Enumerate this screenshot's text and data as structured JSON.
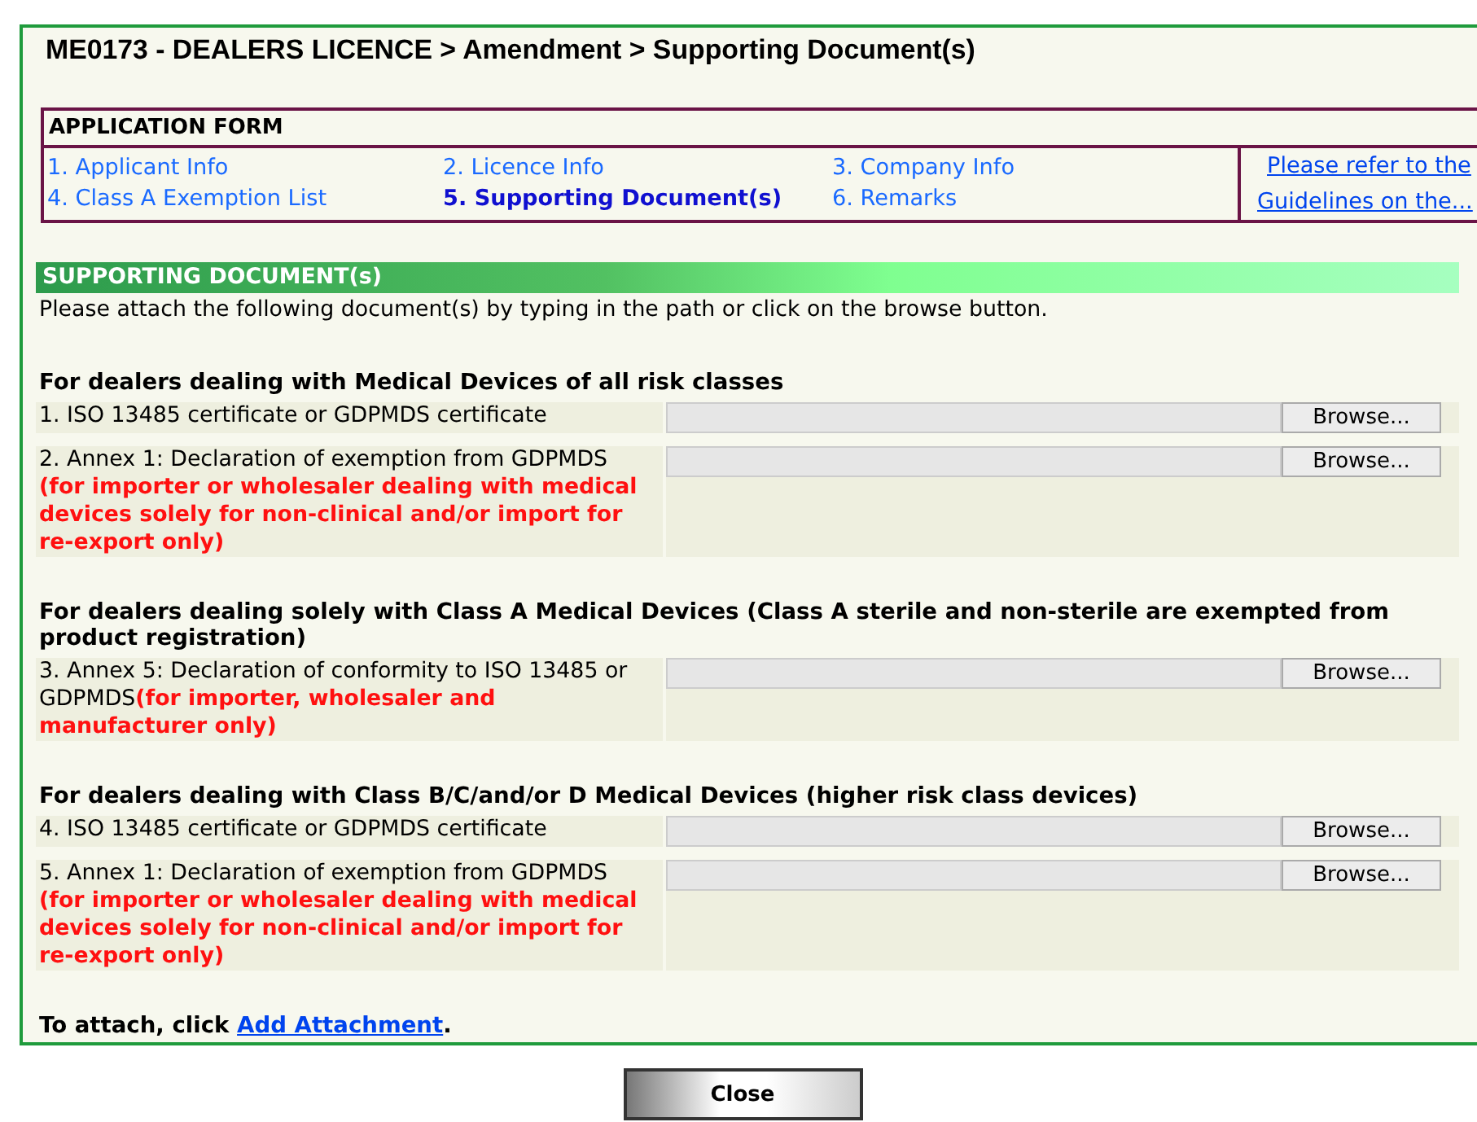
{
  "window": {
    "title": "ME0173 - DEALERS LICENCE > Amendment > Supporting Document(s)"
  },
  "application_form": {
    "title": "APPLICATION FORM",
    "steps": [
      {
        "label": "1. Applicant Info",
        "selected": false
      },
      {
        "label": "2. Licence Info",
        "selected": false
      },
      {
        "label": "3. Company Info",
        "selected": false
      },
      {
        "label": "4. Class A Exemption List",
        "selected": false
      },
      {
        "label": "5. Supporting Document(s)",
        "selected": true
      },
      {
        "label": "6. Remarks",
        "selected": false
      }
    ],
    "guideline_links": [
      "Please refer to the",
      "Guidelines on the..."
    ]
  },
  "section": {
    "title": "SUPPORTING DOCUMENT(s)",
    "intro": "Please attach the following document(s) by typing in the path or click on the browse button.",
    "groups": [
      {
        "heading": "For dealers dealing with Medical Devices of all risk classes",
        "documents": [
          {
            "label": "1. ISO 13485 certificate or GDPMDS certificate",
            "button": "Browse..."
          },
          {
            "label": "2. Annex 1: Declaration of exemption from GDPMDS",
            "note": "(for importer or wholesaler dealing with medical devices solely for non-clinical and/or import for re-export only)",
            "note_on_new_line": true,
            "button": "Browse..."
          }
        ]
      },
      {
        "heading": "For dealers dealing solely with Class A Medical Devices (Class A sterile and non-sterile are exempted from product registration)",
        "documents": [
          {
            "label": "3. Annex 5: Declaration of conformity to ISO 13485 or GDPMDS",
            "note": "(for importer, wholesaler and manufacturer only)",
            "note_on_new_line": false,
            "button": "Browse..."
          }
        ]
      },
      {
        "heading": "For dealers dealing with Class B/C/and/or D Medical Devices (higher risk class devices)",
        "documents": [
          {
            "label": "4. ISO 13485 certificate or GDPMDS certificate",
            "button": "Browse..."
          },
          {
            "label": "5. Annex 1: Declaration of exemption from GDPMDS",
            "note": "(for importer or wholesaler dealing with medical devices solely for non-clinical and/or import for re-export only)",
            "note_on_new_line": true,
            "button": "Browse..."
          }
        ]
      }
    ],
    "attach": {
      "text": "To attach, click",
      "link": "Add Attachment",
      "end": "."
    }
  },
  "buttons": [
    "Close"
  ]
}
